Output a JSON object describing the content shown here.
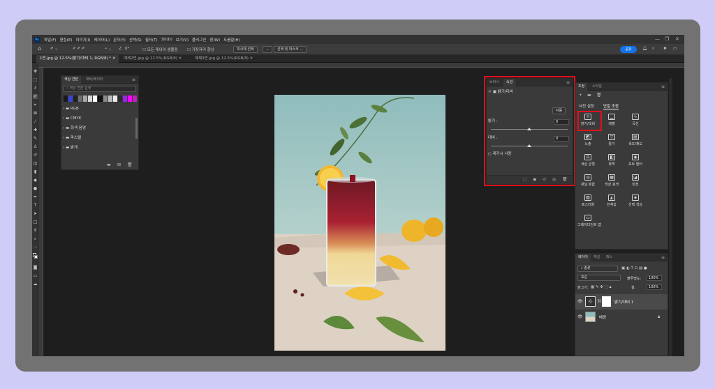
{
  "app": {
    "logo": "Ps"
  },
  "menu": [
    "파일(F)",
    "편집(E)",
    "이미지(I)",
    "레이어(L)",
    "문자(Y)",
    "선택(S)",
    "필터(T)",
    "3D(D)",
    "보기(V)",
    "플러그인",
    "창(W)",
    "도움말(H)"
  ],
  "window_controls": {
    "minimize": "—",
    "restore": "❐",
    "close": "✕"
  },
  "options_bar": {
    "angle": "0°",
    "sample_all_layers": "모든 레이어 샘플링",
    "enhance_edge": "가장자리 향상",
    "subject_select": "피사체 선택",
    "select_mask": "선택 및 마스크 ...",
    "share": "공유"
  },
  "tabs": [
    {
      "label": "1번.jpg @ 12.5%(밝기/대비 1, RGB/8) *",
      "active": true
    },
    {
      "label": "예제2번.jpg @ 12.5%(RGB/8)",
      "active": false
    },
    {
      "label": "예제3번.jpg @ 12.5%(RGB/8)",
      "active": false
    }
  ],
  "swatches_panel": {
    "tabs": [
      "색상 견본",
      "대비/레이터"
    ],
    "search_placeholder": "색상 견본 검색",
    "colors": [
      "#1a1a1a",
      "#3a44d8",
      "#222222",
      "#6e6e6e",
      "#a8a8a8",
      "#d8d8d8",
      "#ffffff",
      "#111111",
      "#8a8a8a",
      "#bcbcbc",
      "#eaeaea",
      "#2b2b2b",
      "#a020f0",
      "#ff00ff",
      "#c020c0"
    ],
    "folders": [
      "RGB",
      "CMYK",
      "회색 음영",
      "파스텔",
      "밝게"
    ]
  },
  "properties_panel": {
    "tabs": [
      "브러시",
      "속성"
    ],
    "layer_label": "밝기/대비",
    "auto_button": "자동",
    "brightness_label": "밝기 :",
    "brightness_value": "0",
    "contrast_label": "대비 :",
    "contrast_value": "0",
    "legacy_label": "레거시 사용"
  },
  "adjustments_panel": {
    "tabs": [
      "조정",
      "스타일"
    ],
    "sub_tabs": [
      "사전 설정",
      "단일 조정"
    ],
    "items": [
      {
        "label": "밝기/대비",
        "icon": "☼"
      },
      {
        "label": "레벨",
        "icon": "▁"
      },
      {
        "label": "곡선",
        "icon": "∿"
      },
      {
        "label": "노출",
        "icon": "◩"
      },
      {
        "label": "활기",
        "icon": "▽"
      },
      {
        "label": "색조/채도",
        "icon": "▤"
      },
      {
        "label": "색상 균형",
        "icon": "⚖"
      },
      {
        "label": "흑백",
        "icon": "◧"
      },
      {
        "label": "포토 필터",
        "icon": "◉"
      },
      {
        "label": "채널 혼합",
        "icon": "◎"
      },
      {
        "label": "색상 검색",
        "icon": "▦"
      },
      {
        "label": "반전",
        "icon": "◪"
      },
      {
        "label": "포스터화",
        "icon": "▨"
      },
      {
        "label": "한계값",
        "icon": "◭"
      },
      {
        "label": "선택 색상",
        "icon": "◈"
      },
      {
        "label": "그레이디언트 맵",
        "icon": "▭"
      }
    ]
  },
  "layers_panel": {
    "tabs": [
      "레이어",
      "채널",
      "패스"
    ],
    "filter_label": "종류",
    "blend_mode": "표준",
    "opacity_label": "불투명도:",
    "opacity_value": "100%",
    "lock_label": "잠그기:",
    "fill_label": "칠:",
    "fill_value": "100%",
    "layers": [
      {
        "name": "밝기/대비 1",
        "type": "adjustment"
      },
      {
        "name": "배경",
        "type": "background"
      }
    ]
  },
  "accent_colors": {
    "highlight": "#e3101c",
    "share": "#1473e6"
  }
}
